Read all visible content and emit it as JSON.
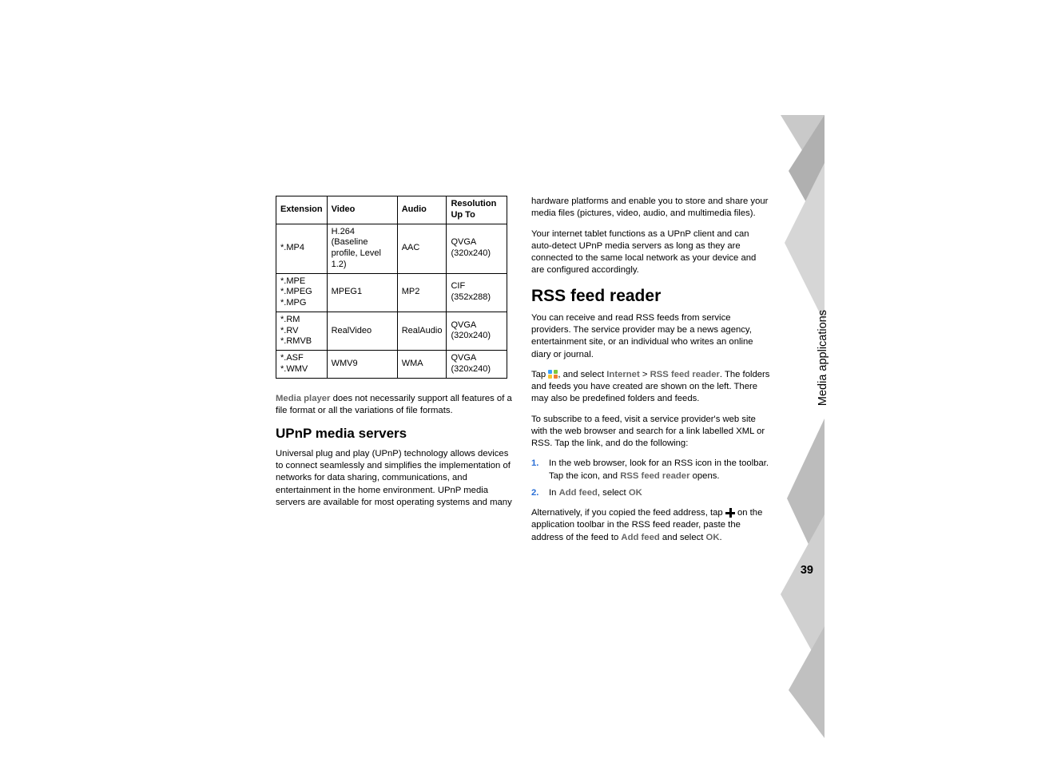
{
  "sidebar": {
    "section_title": "Media applications",
    "page_number": "39"
  },
  "table": {
    "headers": {
      "extension": "Extension",
      "video": "Video",
      "audio": "Audio",
      "resolution": "Resolution Up To"
    },
    "rows": [
      {
        "ext": "*.MP4",
        "video": "H.264 (Baseline profile, Level 1.2)",
        "audio": "AAC",
        "res": "QVGA (320x240)"
      },
      {
        "ext": "*.MPE\n*.MPEG\n*.MPG",
        "video": "MPEG1",
        "audio": "MP2",
        "res": "CIF (352x288)"
      },
      {
        "ext": "*.RM\n*.RV\n*.RMVB",
        "video": "RealVideo",
        "audio": "RealAudio",
        "res": "QVGA (320x240)"
      },
      {
        "ext": "*.ASF\n*.WMV",
        "video": "WMV9",
        "audio": "WMA",
        "res": "QVGA (320x240)"
      }
    ]
  },
  "left": {
    "media_player_note_bold": "Media player",
    "media_player_note_rest": " does not necessarily support all features of a file format or all the variations of file formats.",
    "upnp_heading": "UPnP media servers",
    "upnp_para": "Universal plug and play (UPnP) technology allows devices to connect seamlessly and simplifies the implementation of networks for data sharing, communications, and entertainment in the home environment. UPnP media servers are available for most operating systems and many"
  },
  "right": {
    "continuation_para": "hardware platforms and enable you to store and share your media files (pictures, video, audio, and multimedia files).",
    "upnp_client_para": "Your internet tablet functions as a UPnP client and can auto-detect UPnP media servers as long as they are connected to the same local network as your device and are configured accordingly.",
    "rss_heading": "RSS feed reader",
    "rss_intro": "You can receive and read RSS feeds from service providers. The service provider may be a news agency, entertainment site, or an individual who writes an online diary or journal.",
    "tap_prefix": "Tap ",
    "tap_after_icon": ", and select ",
    "internet_menu": "Internet",
    "gt": " > ",
    "rss_menu": "RSS feed reader",
    "tap_rest": ". The folders and feeds you have created are shown on the left. There may also be predefined folders and feeds.",
    "subscribe_para": "To subscribe to a feed, visit a service provider's web site with the web browser and search for a link labelled XML or RSS. Tap the link, and do the following:",
    "step1_num": "1.",
    "step1_a": "In the web browser, look for an RSS icon in the toolbar. Tap the icon, and ",
    "step1_bold": "RSS feed reader",
    "step1_b": " opens.",
    "step2_num": "2.",
    "step2_a": "In ",
    "step2_addfeed": "Add feed",
    "step2_b": ", select ",
    "step2_ok": "OK",
    "alt_a": "Alternatively, if you copied the feed address, tap ",
    "alt_b": " on the application toolbar in the RSS feed reader, paste the address of the feed to ",
    "alt_addfeed": "Add feed",
    "alt_c": " and select ",
    "alt_ok": "OK",
    "alt_d": "."
  }
}
